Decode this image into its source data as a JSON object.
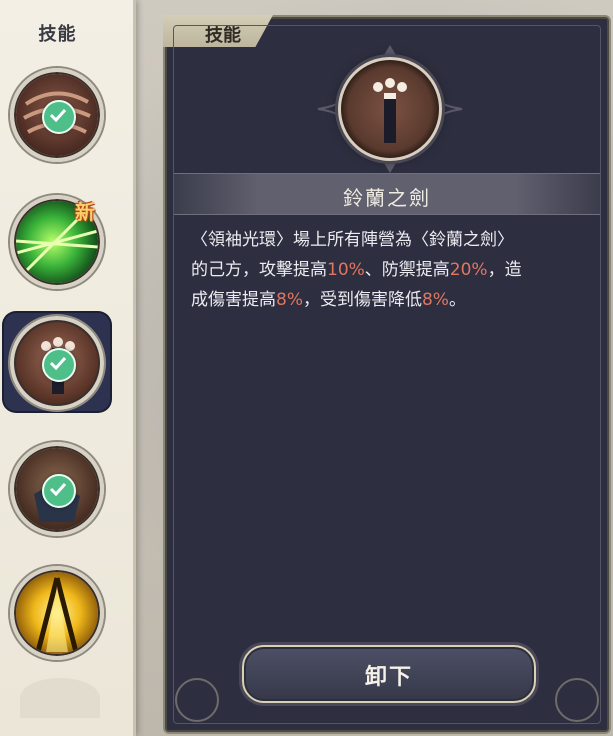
{
  "sidebar": {
    "title": "技能",
    "new_label": "新",
    "slots": [
      {
        "name": "skill-slot-1",
        "equipped": true
      },
      {
        "name": "skill-slot-2",
        "equipped": false,
        "new": true
      },
      {
        "name": "skill-slot-3",
        "equipped": true,
        "selected": true
      },
      {
        "name": "skill-slot-4",
        "equipped": true
      },
      {
        "name": "skill-slot-5",
        "equipped": false
      }
    ]
  },
  "panel": {
    "tab_label": "技能",
    "skill_name": "鈴蘭之劍",
    "description": {
      "line1": "〈領袖光環〉場上所有陣營為〈鈴蘭之劍〉",
      "line2_a": "的己方，攻擊提高",
      "pct_attack": "10%",
      "line2_b": "、防禦提高",
      "pct_defense": "20%",
      "line2_c": "，造",
      "line3_a": "成傷害提高",
      "pct_damage": "8%",
      "line3_b": "，受到傷害降低",
      "pct_taken": "8%",
      "line3_c": "。"
    },
    "button_label": "卸下"
  },
  "colors": {
    "highlight": "#e07660",
    "panel_bg": "#2d2f40",
    "check_green": "#4fbf8a"
  }
}
